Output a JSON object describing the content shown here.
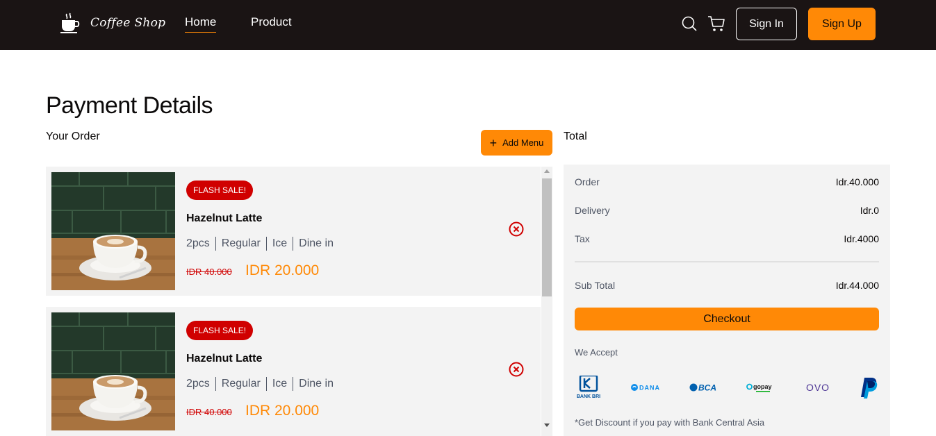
{
  "navbar": {
    "brand": "Coffee Shop",
    "links": [
      {
        "label": "Home",
        "active": true
      },
      {
        "label": "Product",
        "active": false
      }
    ],
    "signin_label": "Sign In",
    "signup_label": "Sign Up"
  },
  "page": {
    "title": "Payment Details",
    "your_order_label": "Your Order",
    "add_menu_label": "Add Menu",
    "total_label": "Total"
  },
  "orders": [
    {
      "badge": "FLASH SALE!",
      "name": "Hazelnut Latte",
      "qty": "2pcs",
      "size": "Regular",
      "temp": "Ice",
      "service": "Dine in",
      "old_price": "IDR 40.000",
      "new_price": "IDR 20.000"
    },
    {
      "badge": "FLASH SALE!",
      "name": "Hazelnut Latte",
      "qty": "2pcs",
      "size": "Regular",
      "temp": "Ice",
      "service": "Dine in",
      "old_price": "IDR 40.000",
      "new_price": "IDR 20.000"
    }
  ],
  "summary": {
    "order_label": "Order",
    "order_value": "Idr.40.000",
    "delivery_label": "Delivery",
    "delivery_value": "Idr.0",
    "tax_label": "Tax",
    "tax_value": "Idr.4000",
    "subtotal_label": "Sub Total",
    "subtotal_value": "Idr.44.000",
    "checkout_label": "Checkout",
    "we_accept_label": "We Accept",
    "payment_methods": [
      "BANK BRI",
      "DANA",
      "BCA",
      "gopay",
      "OVO",
      "PayPal"
    ],
    "discount_note": "*Get Discount if you pay with Bank Central Asia"
  },
  "colors": {
    "accent": "#ff8906",
    "navbar_bg": "#1a1414",
    "sale_red": "#d00000",
    "panel_bg": "#f3f3f3"
  },
  "icons": [
    "coffee-cup-icon",
    "search-icon",
    "cart-icon",
    "plus-icon",
    "remove-circle-x-icon"
  ]
}
